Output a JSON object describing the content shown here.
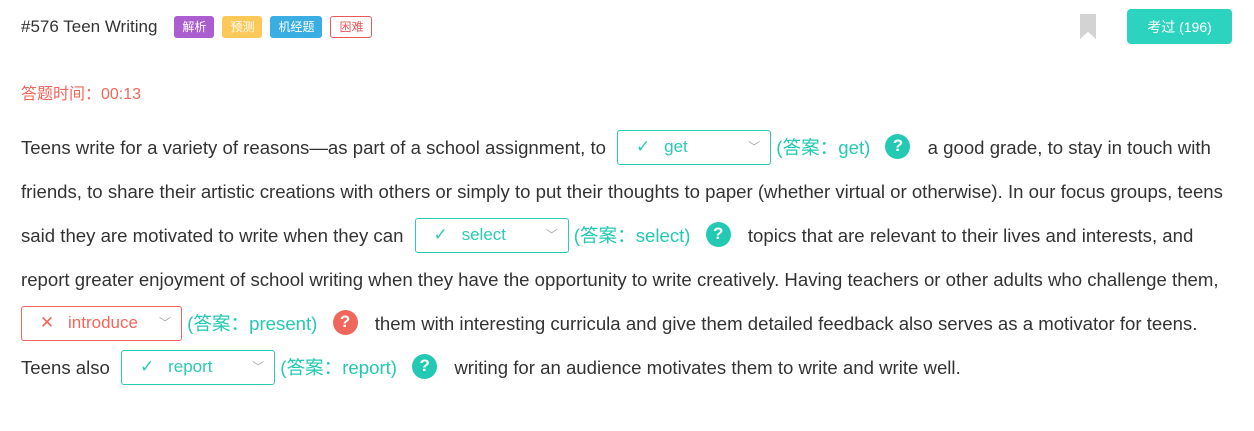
{
  "header": {
    "title": "#576 Teen Writing",
    "tags": [
      "解析",
      "预测",
      "机经题",
      "困难"
    ],
    "done_button": "考过 (196)"
  },
  "timer": "答题时间：00:13",
  "passage": {
    "s1": "Teens write for a variety of reasons—as part of a school assignment, to",
    "s2": "a good grade, to stay in touch with friends, to share their artistic creations with others or simply to put their thoughts to paper (whether virtual or otherwise). In our focus groups, teens said they are motivated to write when they can",
    "s3": "topics that are relevant to their lives and interests, and report greater enjoyment of school writing when they have the opportunity to write creatively. Having teachers or other adults who challenge them,",
    "s4": "them with interesting curricula and give them detailed feedback also serves as a motivator for teens. Teens also",
    "s5": "writing for an audience motivates them to write and write well."
  },
  "blanks": [
    {
      "selected": "get",
      "status": "correct",
      "mark": "✓",
      "answer_text": "(答案：get)",
      "help": "?"
    },
    {
      "selected": "select",
      "status": "correct",
      "mark": "✓",
      "answer_text": "(答案：select)",
      "help": "?"
    },
    {
      "selected": "introduce",
      "status": "wrong",
      "mark": "✕",
      "answer_text": "(答案：present)",
      "help": "?"
    },
    {
      "selected": "report",
      "status": "correct",
      "mark": "✓",
      "answer_text": "(答案：report)",
      "help": "?"
    }
  ],
  "icons": {
    "dropdown": "chevron-down-icon",
    "bookmark": "bookmark-icon"
  },
  "colors": {
    "accent": "#2cd3bf",
    "error": "#f0675b",
    "answer": "#23c9b3"
  }
}
